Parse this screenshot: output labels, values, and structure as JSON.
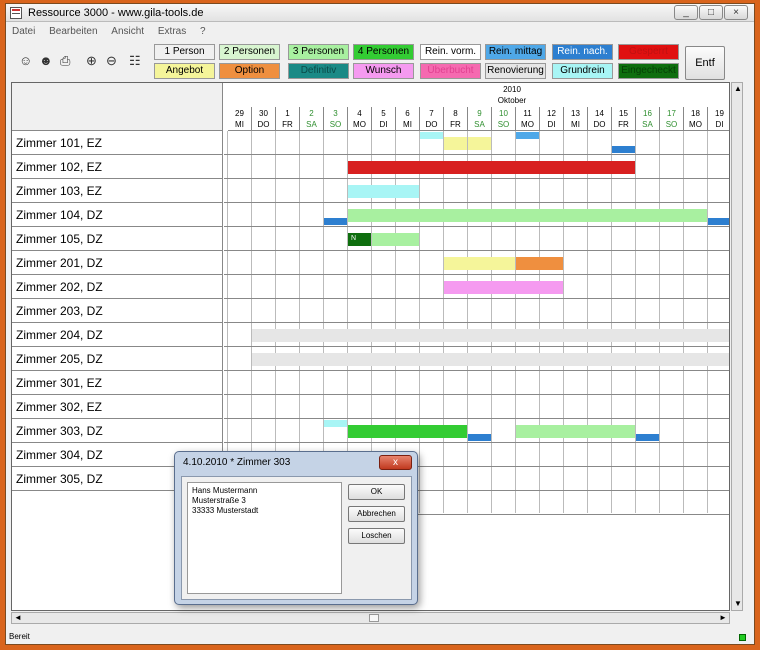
{
  "window": {
    "title": "Ressource 3000 - www.gila-tools.de"
  },
  "menu": [
    "Datei",
    "Bearbeiten",
    "Ansicht",
    "Extras",
    "?"
  ],
  "toolbar_icons": [
    "person-icon",
    "persons-icon",
    "printer-icon",
    "zoom-in-icon",
    "zoom-out-icon",
    "people-group-icon"
  ],
  "legend": [
    {
      "label": "1 Person",
      "bg": "#f0f0f0",
      "fg": "#000000"
    },
    {
      "label": "2 Personen",
      "bg": "#d8f5d0",
      "fg": "#000000"
    },
    {
      "label": "3 Personen",
      "bg": "#a8f0a0",
      "fg": "#000000"
    },
    {
      "label": "4 Personen",
      "bg": "#33cc33",
      "fg": "#000000"
    },
    {
      "label": "Rein. vorm.",
      "bg": "#ffffff",
      "fg": "#000000"
    },
    {
      "label": "Rein. mittag",
      "bg": "#4fa8e8",
      "fg": "#000000"
    },
    {
      "label": "Rein. nach.",
      "bg": "#2d7fd0",
      "fg": "#ffffff"
    },
    {
      "label": "Gesperrt",
      "bg": "#e01010",
      "fg": "#c01010"
    },
    {
      "label": "Angebot",
      "bg": "#f5f59a",
      "fg": "#000000"
    },
    {
      "label": "Option",
      "bg": "#ef8f3f",
      "fg": "#000000"
    },
    {
      "label": "Definitiv",
      "bg": "#1a8a86",
      "fg": "#0a4a48"
    },
    {
      "label": "Wunsch",
      "bg": "#f59af0",
      "fg": "#000000"
    },
    {
      "label": "Überbucht",
      "bg": "#f56ab0",
      "fg": "#e04090"
    },
    {
      "label": "Renovierung",
      "bg": "#e6e6e6",
      "fg": "#000000"
    },
    {
      "label": "Grundrein",
      "bg": "#a8f5f5",
      "fg": "#000000"
    },
    {
      "label": "Eingecheckt",
      "bg": "#0e6e0e",
      "fg": "#064006"
    }
  ],
  "delete_label": "Entf",
  "calendar": {
    "year": "2010",
    "month": "Oktober",
    "days": [
      {
        "num": "29",
        "dow": "MI"
      },
      {
        "num": "30",
        "dow": "DO"
      },
      {
        "num": "1",
        "dow": "FR"
      },
      {
        "num": "2",
        "dow": "SA",
        "weekend": true
      },
      {
        "num": "3",
        "dow": "SO",
        "weekend": true
      },
      {
        "num": "4",
        "dow": "MO"
      },
      {
        "num": "5",
        "dow": "DI"
      },
      {
        "num": "6",
        "dow": "MI"
      },
      {
        "num": "7",
        "dow": "DO"
      },
      {
        "num": "8",
        "dow": "FR"
      },
      {
        "num": "9",
        "dow": "SA",
        "weekend": true
      },
      {
        "num": "10",
        "dow": "SO",
        "weekend": true
      },
      {
        "num": "11",
        "dow": "MO"
      },
      {
        "num": "12",
        "dow": "DI"
      },
      {
        "num": "13",
        "dow": "MI"
      },
      {
        "num": "14",
        "dow": "DO"
      },
      {
        "num": "15",
        "dow": "FR"
      },
      {
        "num": "16",
        "dow": "SA",
        "weekend": true
      },
      {
        "num": "17",
        "dow": "SO",
        "weekend": true
      },
      {
        "num": "18",
        "dow": "MO"
      },
      {
        "num": "19",
        "dow": "DI"
      }
    ]
  },
  "rooms": [
    "Zimmer 101, EZ",
    "Zimmer 102, EZ",
    "Zimmer 103, EZ",
    "Zimmer 104, DZ",
    "Zimmer 105, DZ",
    "Zimmer 201, DZ",
    "Zimmer 202, DZ",
    "Zimmer 203, DZ",
    "Zimmer 204, DZ",
    "Zimmer 205, DZ",
    "Zimmer 301, EZ",
    "Zimmer 302, EZ",
    "Zimmer 303, DZ",
    "Zimmer 304, DZ",
    "Zimmer 305, DZ"
  ],
  "bookings": [
    {
      "room": 0,
      "start": 9,
      "end": 10,
      "color": "#f5f59a"
    },
    {
      "room": 0,
      "start": 10,
      "end": 11,
      "color": "#f5f59a"
    },
    {
      "room": 0,
      "start": 8,
      "end": 9,
      "color": "#a8f5f5",
      "half": "top"
    },
    {
      "room": 0,
      "start": 12,
      "end": 13,
      "color": "#4fa8e8",
      "half": "top"
    },
    {
      "room": 0,
      "start": 16,
      "end": 17,
      "color": "#2d7fd0",
      "half": "bottom"
    },
    {
      "room": 1,
      "start": 5,
      "end": 17,
      "color": "#d82020"
    },
    {
      "room": 2,
      "start": 5,
      "end": 8,
      "color": "#a8f5f5"
    },
    {
      "room": 3,
      "start": 5,
      "end": 20,
      "color": "#a8f0a0"
    },
    {
      "room": 3,
      "start": 4,
      "end": 5,
      "color": "#2d7fd0",
      "half": "bottom"
    },
    {
      "room": 3,
      "start": 20,
      "end": 21,
      "color": "#2d7fd0",
      "half": "bottom"
    },
    {
      "room": 4,
      "start": 5,
      "end": 6,
      "color": "#0e6e0e",
      "text": "N"
    },
    {
      "room": 4,
      "start": 6,
      "end": 8,
      "color": "#a8f0a0"
    },
    {
      "room": 5,
      "start": 9,
      "end": 12,
      "color": "#f5f59a"
    },
    {
      "room": 5,
      "start": 12,
      "end": 14,
      "color": "#ef8f3f"
    },
    {
      "room": 6,
      "start": 9,
      "end": 14,
      "color": "#f59af0"
    },
    {
      "room": 8,
      "start": 1,
      "end": 21,
      "color": "#e6e6e6"
    },
    {
      "room": 9,
      "start": 1,
      "end": 21,
      "color": "#e6e6e6"
    },
    {
      "room": 12,
      "start": 5,
      "end": 10,
      "color": "#33cc33"
    },
    {
      "room": 12,
      "start": 12,
      "end": 17,
      "color": "#a8f0a0"
    },
    {
      "room": 12,
      "start": 10,
      "end": 11,
      "color": "#2d7fd0",
      "half": "bottom"
    },
    {
      "room": 12,
      "start": 17,
      "end": 18,
      "color": "#2d7fd0",
      "half": "bottom"
    },
    {
      "room": 12,
      "start": 4,
      "end": 5,
      "color": "#a8f5f5",
      "half": "top"
    }
  ],
  "dialog": {
    "title": "4.10.2010 * Zimmer 303",
    "close_label": "x",
    "text": "Hans Mustermann\nMusterstraße 3\n33333 Musterstadt",
    "ok_label": "OK",
    "cancel_label": "Abbrechen",
    "delete_label": "Loschen"
  },
  "status": {
    "text": "Bereit"
  }
}
